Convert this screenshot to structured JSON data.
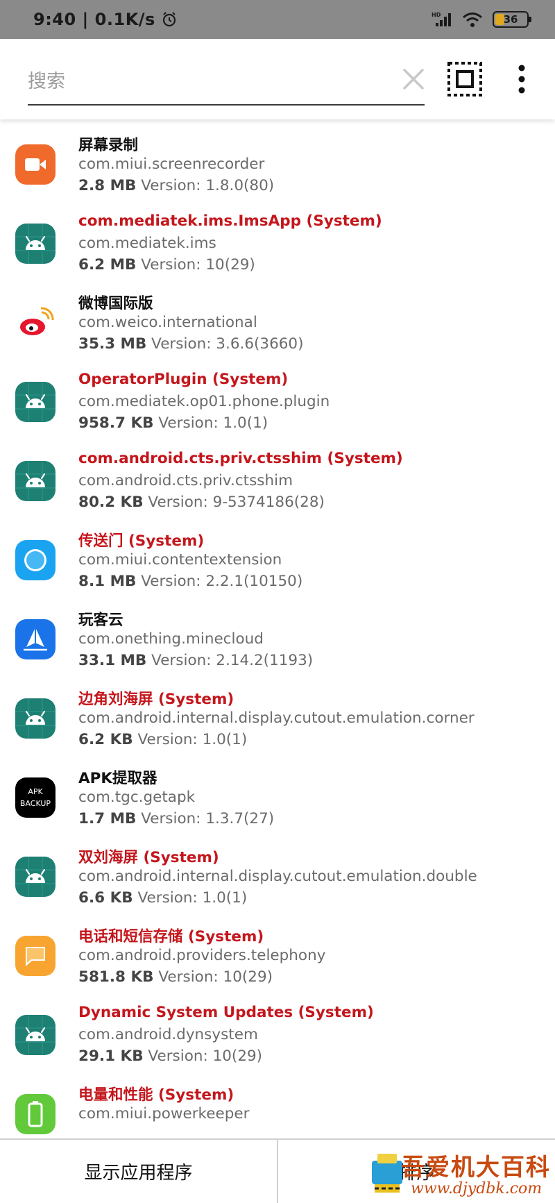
{
  "status_bar": {
    "time_speed": "9:40 | 0.1K/s",
    "network_label": "HD",
    "battery_level": "36"
  },
  "search": {
    "placeholder": "搜索",
    "value": ""
  },
  "colors": {
    "system_app_name": "#c4161c",
    "user_app_name": "#111111",
    "secondary_text": "#6b6b6b",
    "android_icon_bg": "#1e7f73",
    "status_bar_bg": "#8a8a8a"
  },
  "apps": [
    {
      "name": "屏幕录制",
      "system": false,
      "package": "com.miui.screenrecorder",
      "size": "2.8 MB",
      "version": " Version: 1.8.0(80)",
      "icon": "screen-recorder-icon"
    },
    {
      "name": "com.mediatek.ims.ImsApp (System)",
      "system": true,
      "package": "com.mediatek.ims",
      "size": "6.2 MB",
      "version": " Version: 10(29)",
      "icon": "android-icon"
    },
    {
      "name": "微博国际版",
      "system": false,
      "package": "com.weico.international",
      "size": "35.3 MB",
      "version": " Version: 3.6.6(3660)",
      "icon": "weibo-icon"
    },
    {
      "name": "OperatorPlugin (System)",
      "system": true,
      "package": "com.mediatek.op01.phone.plugin",
      "size": "958.7 KB",
      "version": " Version: 1.0(1)",
      "icon": "android-icon"
    },
    {
      "name": "com.android.cts.priv.ctsshim (System)",
      "system": true,
      "package": "com.android.cts.priv.ctsshim",
      "size": "80.2 KB",
      "version": " Version: 9-5374186(28)",
      "icon": "android-icon"
    },
    {
      "name": "传送门 (System)",
      "system": true,
      "package": "com.miui.contentextension",
      "size": "8.1 MB",
      "version": " Version: 2.2.1(10150)",
      "icon": "content-extension-icon"
    },
    {
      "name": "玩客云",
      "system": false,
      "package": "com.onething.minecloud",
      "size": "33.1 MB",
      "version": " Version: 2.14.2(1193)",
      "icon": "minecloud-icon"
    },
    {
      "name": "边角刘海屏 (System)",
      "system": true,
      "package": "com.android.internal.display.cutout.emulation.corner",
      "size": "6.2 KB",
      "version": " Version: 1.0(1)",
      "icon": "android-icon"
    },
    {
      "name": "APK提取器",
      "system": false,
      "package": "com.tgc.getapk",
      "size": "1.7 MB",
      "version": " Version: 1.3.7(27)",
      "icon": "apk-backup-icon",
      "icon_text": [
        "APK",
        "BACKUP"
      ]
    },
    {
      "name": "双刘海屏 (System)",
      "system": true,
      "package": "com.android.internal.display.cutout.emulation.double",
      "size": "6.6 KB",
      "version": " Version: 1.0(1)",
      "icon": "android-icon"
    },
    {
      "name": "电话和短信存储 (System)",
      "system": true,
      "package": "com.android.providers.telephony",
      "size": "581.8 KB",
      "version": " Version: 10(29)",
      "icon": "telephony-icon"
    },
    {
      "name": "Dynamic System Updates (System)",
      "system": true,
      "package": "com.android.dynsystem",
      "size": "29.1 KB",
      "version": " Version: 10(29)",
      "icon": "android-icon"
    },
    {
      "name": "电量和性能 (System)",
      "system": true,
      "package": "com.miui.powerkeeper",
      "size": "",
      "version": "",
      "icon": "powerkeeper-icon"
    }
  ],
  "bottom_bar": {
    "show_apps_label": "显示应用程序",
    "sort_label": "排序"
  },
  "watermark": {
    "title": "吾爱机大百科",
    "url": "www.djydbk.com"
  }
}
